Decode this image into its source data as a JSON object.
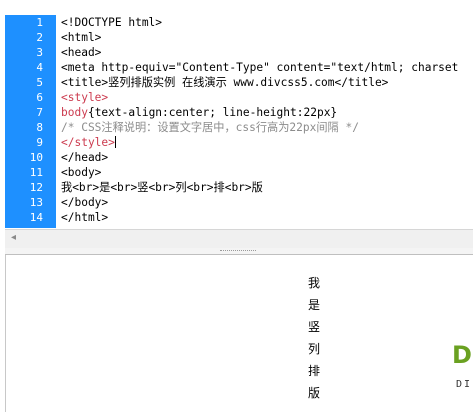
{
  "editor": {
    "line_numbers": [
      "1",
      "2",
      "3",
      "4",
      "5",
      "6",
      "7",
      "8",
      "9",
      "10",
      "11",
      "12",
      "13",
      "14"
    ],
    "lines": [
      {
        "text": "<!DOCTYPE html>",
        "style": "normal"
      },
      {
        "text": "<html>",
        "style": "normal"
      },
      {
        "text": "<head>",
        "style": "normal"
      },
      {
        "text": "<meta http-equiv=\"Content-Type\" content=\"text/html; charset",
        "style": "normal"
      },
      {
        "text": "<title>竖列排版实例 在线演示 www.divcss5.com</title>",
        "style": "normal"
      },
      {
        "text": "<style>",
        "style": "tag-red"
      },
      {
        "text": "body{text-align:center; line-height:22px}",
        "style": "css"
      },
      {
        "text": "/* CSS注释说明：设置文字居中，css行高为22px间隔 */",
        "style": "comment"
      },
      {
        "text": "</style>",
        "style": "tag-red"
      },
      {
        "text": "</head>",
        "style": "normal"
      },
      {
        "text": "<body>",
        "style": "normal"
      },
      {
        "text": "我<br>是<br>竖<br>列<br>排<br>版",
        "style": "normal"
      },
      {
        "text": "</body>",
        "style": "normal"
      },
      {
        "text": "</html>",
        "style": "normal"
      }
    ],
    "css_selector": "body",
    "css_rest": "{text-align:center; line-height:22px}"
  },
  "scrollbar": {
    "left_arrow": "◂"
  },
  "preview": {
    "characters": [
      "我",
      "是",
      "竖",
      "列",
      "排",
      "版"
    ]
  },
  "logo": {
    "letter": "D",
    "sub": "DI"
  },
  "colors": {
    "gutter": "#1e90ff",
    "tag_red": "#cc3b4f",
    "comment": "#8c8c8c",
    "logo_green": "#6aa121"
  }
}
